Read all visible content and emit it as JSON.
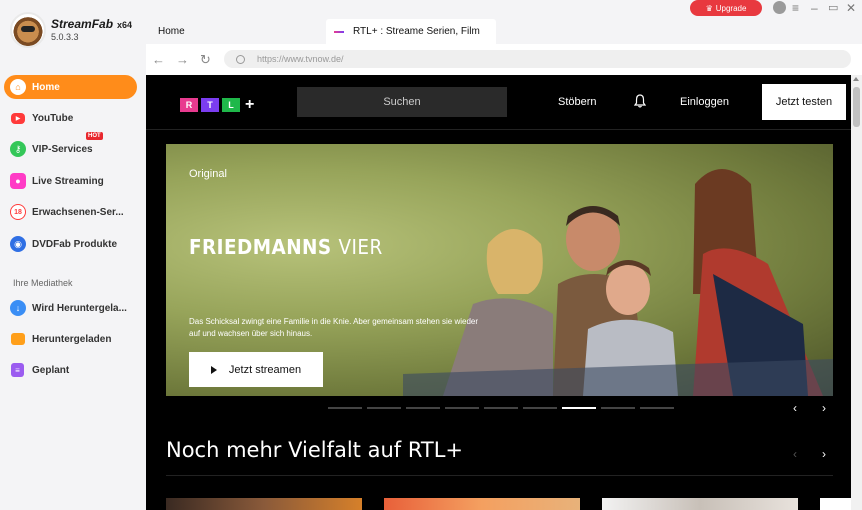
{
  "app": {
    "name": "StreamFab",
    "arch": "x64",
    "version": "5.0.3.3",
    "upgrade_label": "Upgrade"
  },
  "sidebar": {
    "items": [
      {
        "label": "Home",
        "icon": "home-icon",
        "color": "#ff8c1a"
      },
      {
        "label": "YouTube",
        "icon": "youtube-icon",
        "color": "#ff3a3a"
      },
      {
        "label": "VIP-Services",
        "icon": "key-icon",
        "color": "#34c759",
        "badge": "HOT"
      },
      {
        "label": "Live Streaming",
        "icon": "camera-icon",
        "color": "#ff3bc6"
      },
      {
        "label": "Erwachsenen-Ser...",
        "icon": "adult-icon",
        "color": "#ff5a5a"
      },
      {
        "label": "DVDFab Produkte",
        "icon": "dvdfab-icon",
        "color": "#2f6fe4"
      }
    ],
    "library_label": "Ihre Mediathek",
    "library": [
      {
        "label": "Wird Herunterge​la...",
        "icon": "download-icon",
        "color": "#3a8ef5"
      },
      {
        "label": "Heruntergeladen",
        "icon": "folder-icon",
        "color": "#ff9f1a"
      },
      {
        "label": "Geplant",
        "icon": "list-icon",
        "color": "#9b5cf0"
      }
    ]
  },
  "tabs": {
    "home": "Home",
    "active": "RTL+ : Streame Serien, Film"
  },
  "address": {
    "url": "https://www.tvnow.de/"
  },
  "site": {
    "logo_letters": [
      "R",
      "T",
      "L"
    ],
    "logo_colors": [
      "#e83b8f",
      "#7b3df0",
      "#1fb84a"
    ],
    "logo_plus": "+",
    "search_label": "Suchen",
    "browse_label": "Stöbern",
    "login_label": "Einloggen",
    "trial_label": "Jetzt testen",
    "hero": {
      "label": "Original",
      "title_bold": "FRIEDMANNS ",
      "title_light": "VIER",
      "description": "Das Schicksal zwingt eine Familie in die Knie. Aber gemeinsam stehen sie wieder auf und wachsen über sich hinaus.",
      "cta": "Jetzt streamen"
    },
    "carousel": {
      "count": 9,
      "active": 6
    },
    "section_title": "Noch mehr Vielfalt auf RTL+"
  }
}
